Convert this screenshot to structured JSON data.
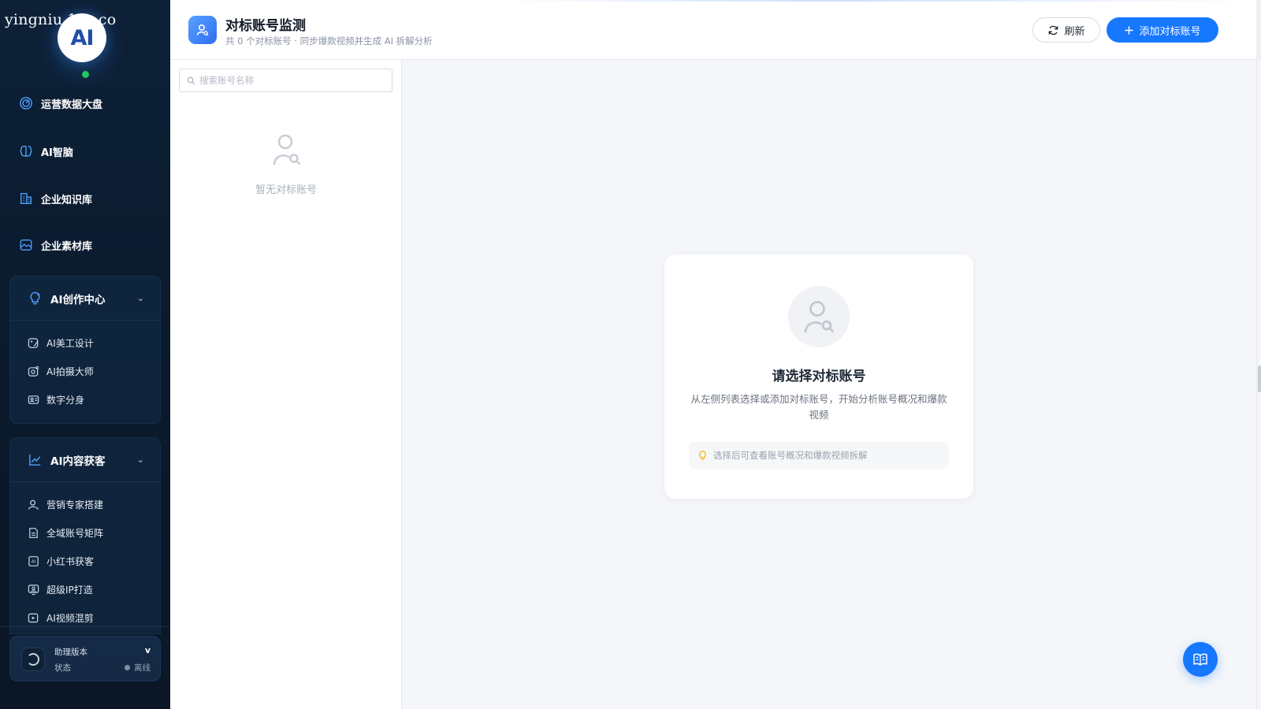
{
  "watermark": "yingniu.10v.co",
  "logo_text": "AI",
  "sidebar": {
    "nav": [
      {
        "label": "运营数据大盘",
        "icon": "dashboard-icon"
      },
      {
        "label": "AI智脑",
        "icon": "brain-icon"
      },
      {
        "label": "企业知识库",
        "icon": "building-icon"
      },
      {
        "label": "企业素材库",
        "icon": "image-icon"
      }
    ],
    "groups": [
      {
        "title": "AI创作中心",
        "icon": "bulb-icon",
        "items": [
          {
            "label": "AI美工设计",
            "icon": "palette-icon"
          },
          {
            "label": "AI拍摄大师",
            "icon": "camera-icon"
          },
          {
            "label": "数字分身",
            "icon": "digital-avatar-icon"
          }
        ]
      },
      {
        "title": "AI内容获客",
        "icon": "trend-chart-icon",
        "items": [
          {
            "label": "营销专家搭建",
            "icon": "expert-icon"
          },
          {
            "label": "全域账号矩阵",
            "icon": "document-icon"
          },
          {
            "label": "小红书获客",
            "icon": "xiaohongshu-icon"
          },
          {
            "label": "超级IP打造",
            "icon": "ip-icon"
          },
          {
            "label": "AI视频混剪",
            "icon": "video-icon"
          }
        ]
      }
    ],
    "version_card": {
      "label": "助理版本",
      "version": "v",
      "status_label": "状态",
      "status_value": "离线"
    }
  },
  "header": {
    "title": "对标账号监测",
    "subtitle": "共 0 个对标账号 · 同步爆款视频并生成 AI 拆解分析",
    "refresh_label": "刷新",
    "add_label": "添加对标账号"
  },
  "list_panel": {
    "search_placeholder": "搜索账号名称",
    "empty_text": "暂无对标账号"
  },
  "main": {
    "empty_title": "请选择对标账号",
    "empty_desc": "从左侧列表选择或添加对标账号，开始分析账号概况和爆款视频",
    "tip": "选择后可查看账号概况和爆款视频拆解"
  },
  "colors": {
    "primary": "#1677ff",
    "sidebar_bg": "#0d2036",
    "online": "#22c55e",
    "tip_bulb": "#f5b400"
  }
}
